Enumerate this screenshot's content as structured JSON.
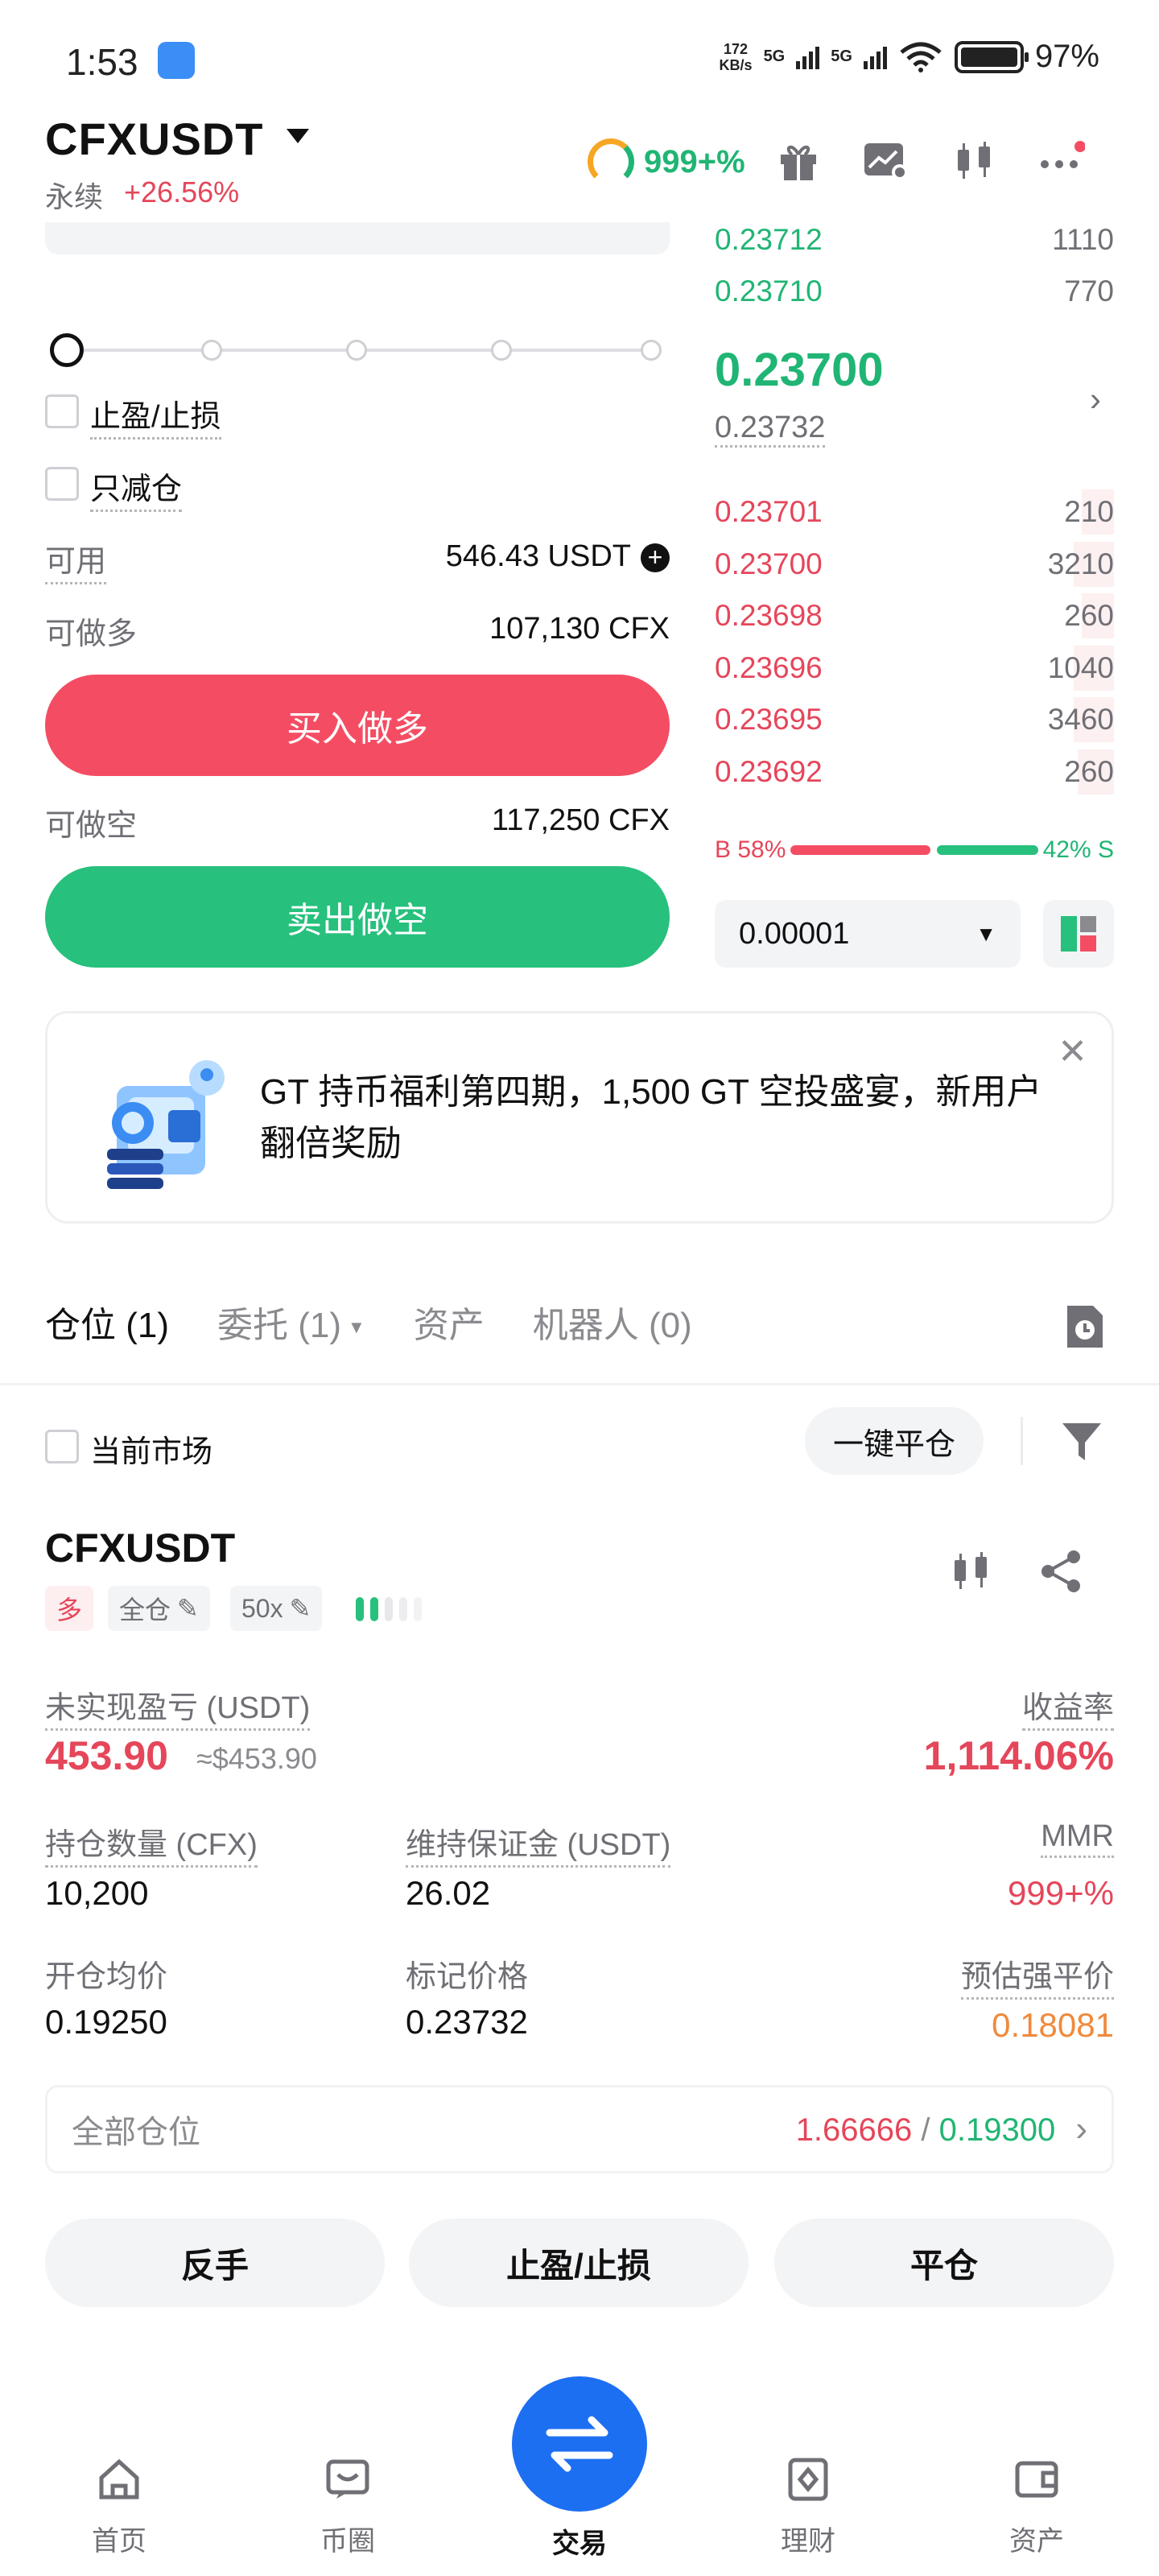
{
  "status_bar": {
    "time": "1:53",
    "net_speed_value": "172",
    "net_speed_unit": "KB/s",
    "signal1": "5G",
    "signal2": "5G",
    "battery": "97%"
  },
  "header": {
    "pair": "CFXUSDT",
    "type": "永续",
    "change": "+26.56%",
    "risk_value": "999+%",
    "icons": [
      "gift-icon",
      "chart-settings-icon",
      "candlestick-icon",
      "more-icon"
    ]
  },
  "order_form": {
    "tp_sl_label": "止盈/止损",
    "reduce_only_label": "只减仓",
    "available_label": "可用",
    "available_value": "546.43 USDT",
    "can_long_label": "可做多",
    "can_long_value": "107,130 CFX",
    "buy_button": "买入做多",
    "can_short_label": "可做空",
    "can_short_value": "117,250 CFX",
    "sell_button": "卖出做空"
  },
  "orderbook": {
    "top_rows": [
      {
        "price": "0.23712",
        "qty": "1110"
      },
      {
        "price": "0.23710",
        "qty": "770"
      }
    ],
    "last_price": "0.23700",
    "mark_price": "0.23732",
    "asks": [
      {
        "price": "0.23701",
        "qty": "210",
        "depth": 0.08
      },
      {
        "price": "0.23700",
        "qty": "3210",
        "depth": 0.1
      },
      {
        "price": "0.23698",
        "qty": "260",
        "depth": 0.08
      },
      {
        "price": "0.23696",
        "qty": "1040",
        "depth": 0.1
      },
      {
        "price": "0.23695",
        "qty": "3460",
        "depth": 0.1
      },
      {
        "price": "0.23692",
        "qty": "260",
        "depth": 0.09
      }
    ],
    "buy_ratio": "B 58%",
    "sell_ratio": "42% S",
    "buy_ratio_value": 58,
    "precision": "0.00001"
  },
  "banner": {
    "text": "GT 持币福利第四期，1,500 GT 空投盛宴，新用户翻倍奖励"
  },
  "tabs": [
    {
      "label": "仓位 (1)",
      "active": true
    },
    {
      "label": "委托 (1)",
      "active": false
    },
    {
      "label": "资产",
      "active": false
    },
    {
      "label": "机器人 (0)",
      "active": false
    }
  ],
  "filter": {
    "current_market": "当前市场",
    "close_all": "一键平仓"
  },
  "position": {
    "pair": "CFXUSDT",
    "side_tag": "多",
    "margin_tag": "全仓",
    "leverage_tag": "50x",
    "unrealized_label": "未实现盈亏 (USDT)",
    "unrealized_value": "453.90",
    "unrealized_usd": "≈$453.90",
    "roe_label": "收益率",
    "roe_value": "1,114.06%",
    "size_label": "持仓数量 (CFX)",
    "size_value": "10,200",
    "maint_label": "维持保证金 (USDT)",
    "maint_value": "26.02",
    "mmr_label": "MMR",
    "mmr_value": "999+%",
    "entry_label": "开仓均价",
    "entry_value": "0.19250",
    "mark_label": "标记价格",
    "mark_value": "0.23732",
    "liq_label": "预估强平价",
    "liq_value": "0.18081",
    "all_positions_label": "全部仓位",
    "all_positions_red": "1.66666",
    "all_positions_sep": " / ",
    "all_positions_green": "0.19300",
    "btn_reverse": "反手",
    "btn_tpsl": "止盈/止损",
    "btn_close": "平仓"
  },
  "bottom_nav": [
    {
      "label": "首页"
    },
    {
      "label": "币圈"
    },
    {
      "label": "交易"
    },
    {
      "label": "理财"
    },
    {
      "label": "资产"
    }
  ],
  "colors": {
    "red": "#e5465a",
    "green": "#20b574",
    "orange": "#f08a3c",
    "blue": "#1d6ff2"
  }
}
